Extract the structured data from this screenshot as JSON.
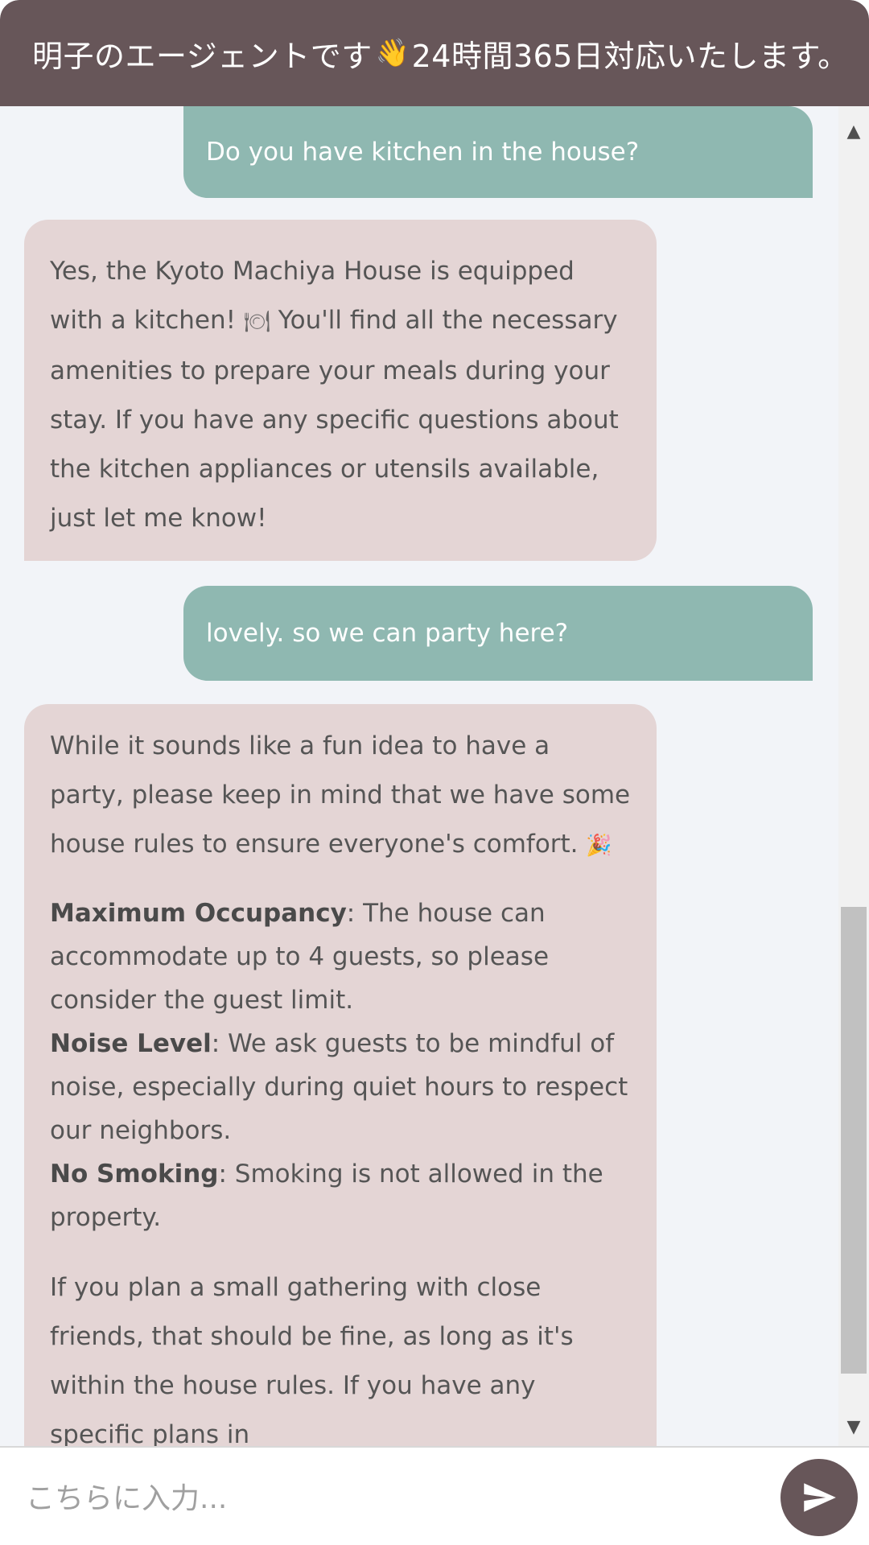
{
  "header": {
    "title_before": "明子のエージェントです",
    "wave_emoji": "👋",
    "title_after": "24時間365日対応いたします。"
  },
  "messages": {
    "user1": "Do you have kitchen in the house?",
    "bot1": {
      "text1": "Yes, the Kyoto Machiya House is equipped with a kitchen!",
      "emoji": "🍽",
      "text2": "You'll find all the necessary amenities to prepare your meals during your stay. If you have any specific questions about the kitchen appliances or utensils available, just let me know!"
    },
    "user2": "lovely. so we can party here?",
    "bot2": {
      "intro": "While it sounds like a fun idea to have a party, please keep in mind that we have some house rules to ensure everyone's comfort.",
      "intro_emoji": "🎉",
      "rule1_title": "Maximum Occupancy",
      "rule1_text": ": The house can accommodate up to 4 guests, so please consider the guest limit.",
      "rule2_title": "Noise Level",
      "rule2_text": ": We ask guests to be mindful of noise, especially during quiet hours to respect our neighbors.",
      "rule3_title": "No Smoking",
      "rule3_text": ": Smoking is not allowed in the property.",
      "closing": "If you plan a small gathering with close friends, that should be fine, as long as it's within the house rules. If you have any specific plans in"
    }
  },
  "input": {
    "placeholder": "こちらに入力..."
  },
  "icons": {
    "send": "send-icon",
    "scroll_up": "scroll-up-arrow",
    "scroll_down": "scroll-down-arrow"
  },
  "colors": {
    "header": "#675659",
    "user_bubble": "#8fb8b1",
    "bot_bubble": "#e4d5d5",
    "chat_background": "#f2f4f8"
  }
}
